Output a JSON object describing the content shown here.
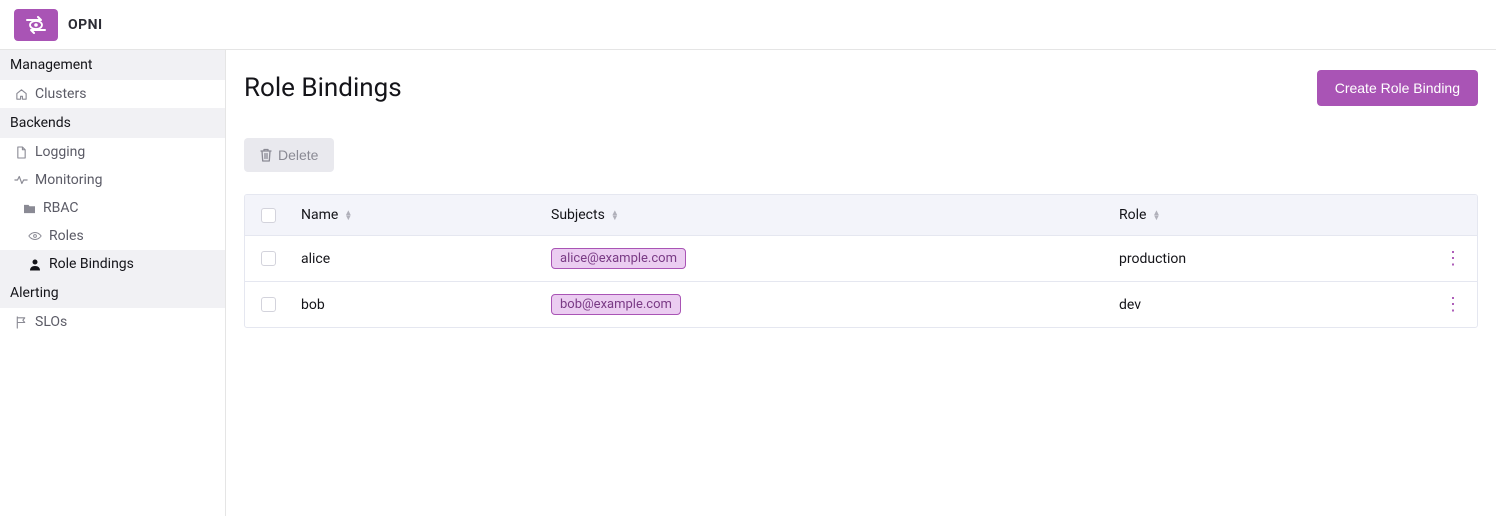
{
  "brand": "OPNI",
  "sidebar": {
    "groups": [
      {
        "header": "Management",
        "items": [
          {
            "icon": "home",
            "label": "Clusters"
          }
        ]
      },
      {
        "header": "Backends",
        "items": [
          {
            "icon": "file",
            "label": "Logging"
          },
          {
            "icon": "pulse",
            "label": "Monitoring"
          },
          {
            "icon": "folder",
            "label": "RBAC",
            "indent": 2
          },
          {
            "icon": "eye",
            "label": "Roles",
            "indent": 3
          },
          {
            "icon": "person",
            "label": "Role Bindings",
            "indent": 3,
            "active": true
          }
        ]
      },
      {
        "header": "Alerting",
        "items": [
          {
            "icon": "flag",
            "label": "SLOs"
          }
        ]
      }
    ]
  },
  "page": {
    "title": "Role Bindings",
    "createButton": "Create Role Binding",
    "deleteButton": "Delete"
  },
  "table": {
    "headers": {
      "name": "Name",
      "subjects": "Subjects",
      "role": "Role"
    },
    "rows": [
      {
        "name": "alice",
        "subject": "alice@example.com",
        "role": "production"
      },
      {
        "name": "bob",
        "subject": "bob@example.com",
        "role": "dev"
      }
    ]
  }
}
